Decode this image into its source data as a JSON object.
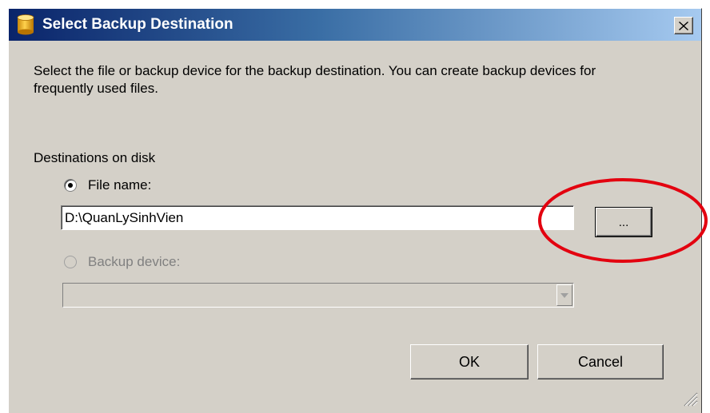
{
  "window": {
    "title": "Select Backup Destination",
    "close_label": "✕"
  },
  "description": "Select the file or backup device for the backup destination. You can create backup devices for frequently used files.",
  "destinations": {
    "section_label": "Destinations on disk",
    "file_name_label": "File name:",
    "file_name_value": "D:\\QuanLySinhVien",
    "file_name_selected": true,
    "browse_label": "...",
    "backup_device_label": "Backup device:",
    "backup_device_value": "",
    "backup_device_enabled": false
  },
  "buttons": {
    "ok_label": "OK",
    "cancel_label": "Cancel"
  },
  "colors": {
    "dialog_face": "#d4d0c8",
    "titlebar_start": "#0a246a",
    "titlebar_end": "#a6caf0",
    "highlight": "#e3000f",
    "disabled_text": "#808080"
  },
  "icons": {
    "title": "database-cylinder-icon",
    "close": "close-icon",
    "dropdown": "chevron-down-icon",
    "resize": "resize-grip-icon"
  }
}
